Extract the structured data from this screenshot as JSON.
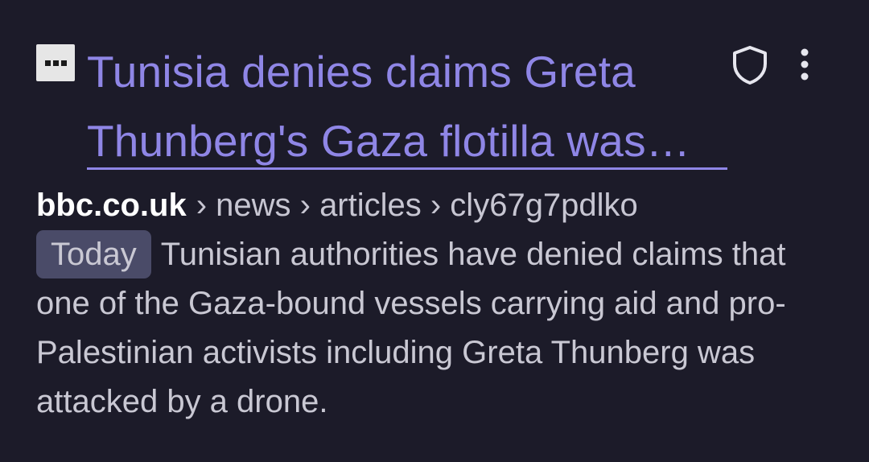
{
  "result": {
    "favicon_icon": "placeholder-favicon-icon",
    "title_line1": "Tunisia denies claims Greta",
    "title_line2": "Thunberg's Gaza flotilla was…",
    "domain": "bbc.co.uk",
    "path": "› news › articles › cly67g7pdlko",
    "date_badge": "Today",
    "snippet": "Tunisian authorities have denied claims that one of the Gaza-bound vessels carrying aid and pro-Palestinian activists including Greta Thunberg was attacked by a drone.",
    "privacy_icon": "shield-icon",
    "menu_icon": "more-vert-icon"
  },
  "colors": {
    "background": "#1c1b29",
    "title": "#8f86e6",
    "badge_bg": "#4a4b68",
    "text": "#c9c8d3"
  }
}
